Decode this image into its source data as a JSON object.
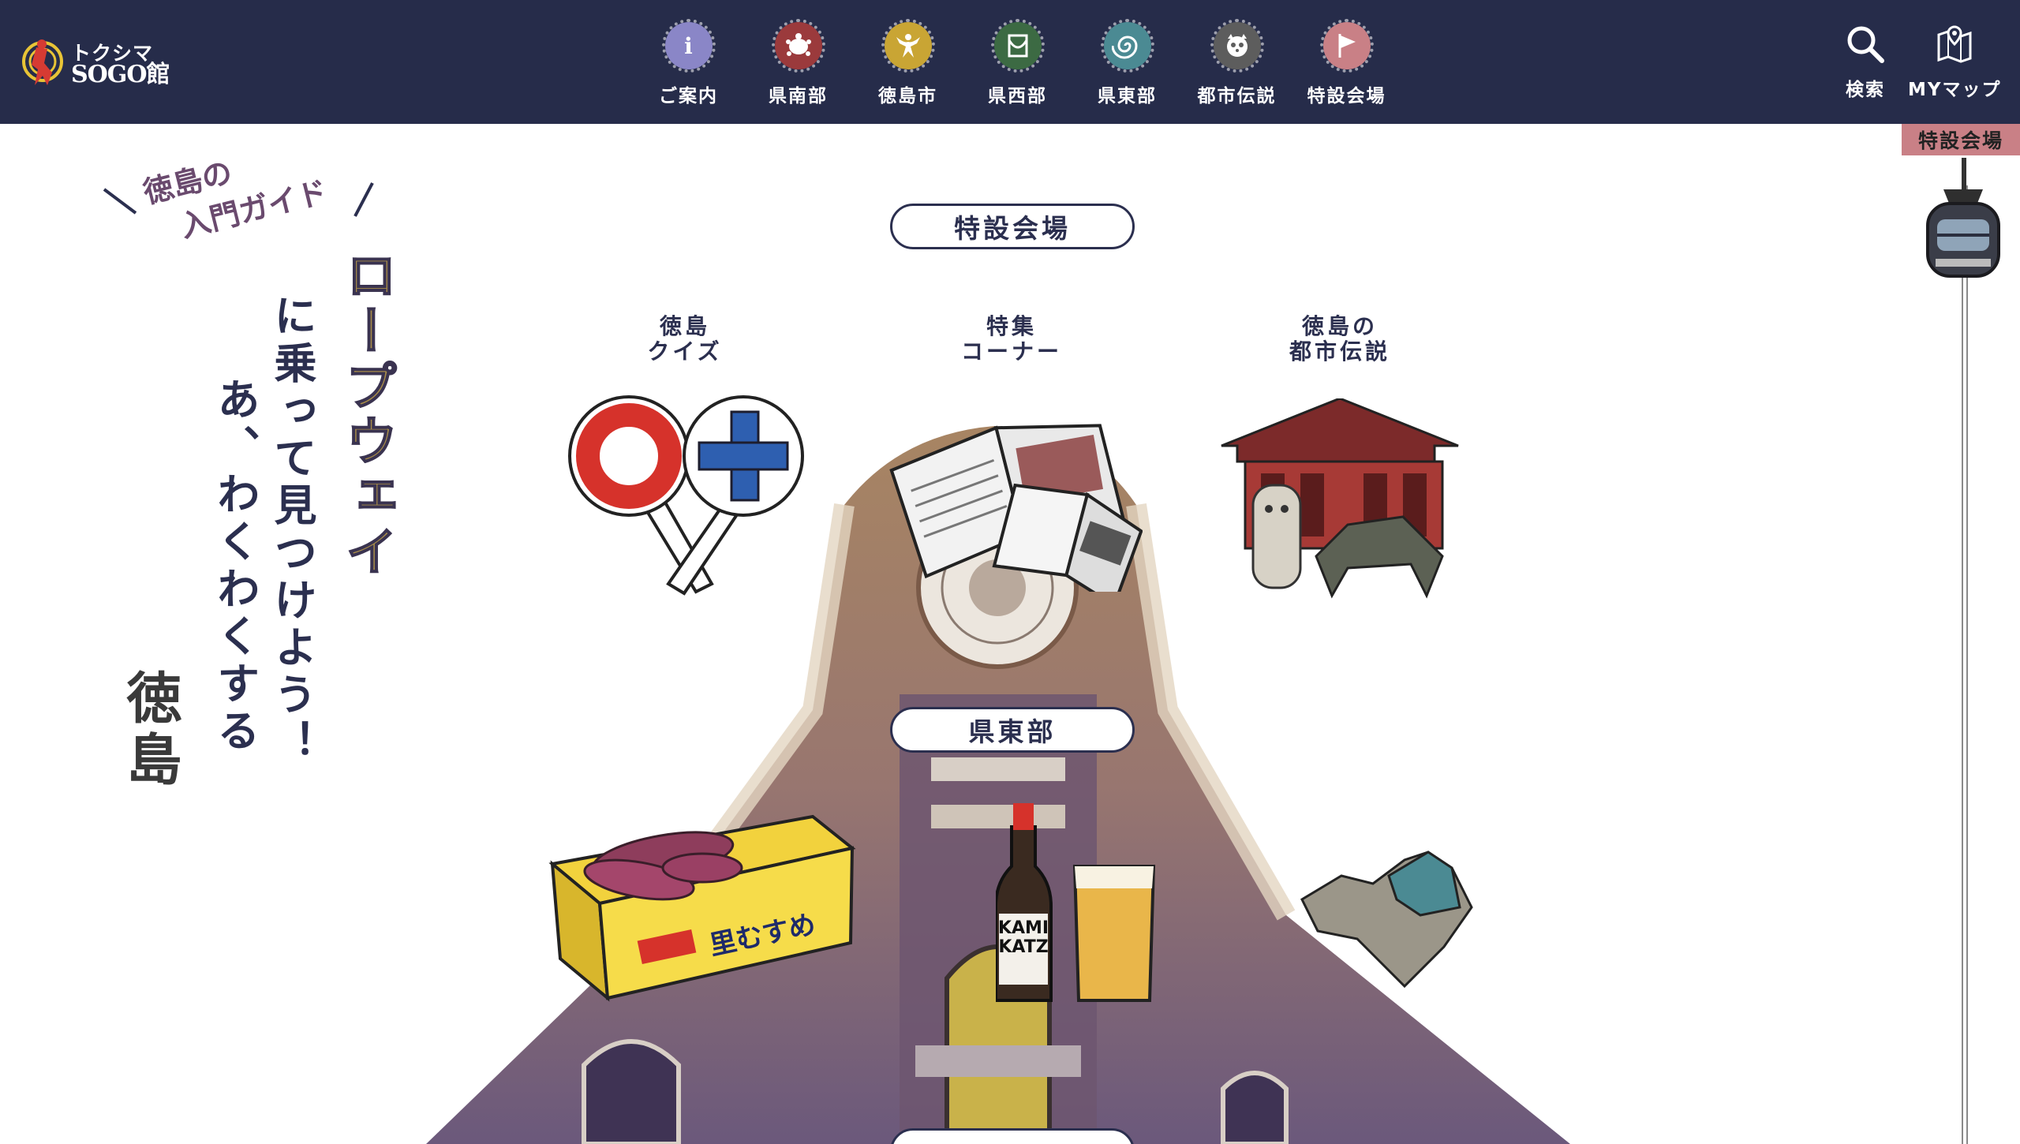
{
  "header": {
    "logo": {
      "sub": "トクシマ",
      "main": "SOGO館"
    },
    "nav": [
      {
        "label": "ご案内",
        "icon": "info-icon",
        "glyph": "i",
        "color": "#8a86c7"
      },
      {
        "label": "県南部",
        "icon": "turtle-icon",
        "glyph": "",
        "color": "#9b3a3c"
      },
      {
        "label": "徳島市",
        "icon": "dancer-icon",
        "glyph": "",
        "color": "#c9a534"
      },
      {
        "label": "県西部",
        "icon": "vine-bridge-icon",
        "glyph": "",
        "color": "#3c6a43"
      },
      {
        "label": "県東部",
        "icon": "whirlpool-icon",
        "glyph": "",
        "color": "#4b8a93"
      },
      {
        "label": "都市伝説",
        "icon": "raccoon-icon",
        "glyph": "",
        "color": "#5d5d5d"
      },
      {
        "label": "特設会場",
        "icon": "flag-icon",
        "glyph": "",
        "color": "#c98086"
      }
    ],
    "search_label": "検索",
    "mymap_label": "MYマップ"
  },
  "rail": {
    "tag": "特設会場"
  },
  "intro": {
    "caption_line1": "徳島の",
    "caption_line2": "入門ガイド",
    "ropeway": "ロープウェイ",
    "find": "に乗って見つけよう！",
    "waku": "あ、わくわくする",
    "tokushima": "徳島"
  },
  "sections": {
    "special": "特設会場",
    "east": "県東部"
  },
  "categories": [
    {
      "label": "徳島\nクイズ"
    },
    {
      "label": "特集\nコーナー"
    },
    {
      "label": "徳島の\n都市伝説"
    }
  ],
  "art_text": {
    "beer": "KAMI\nKATZ",
    "box": "里むすめ"
  },
  "colors": {
    "header_bg": "#262c4a",
    "accent_pink": "#c98086",
    "ink": "#2b2f4f",
    "gold": "#a88d4a"
  }
}
